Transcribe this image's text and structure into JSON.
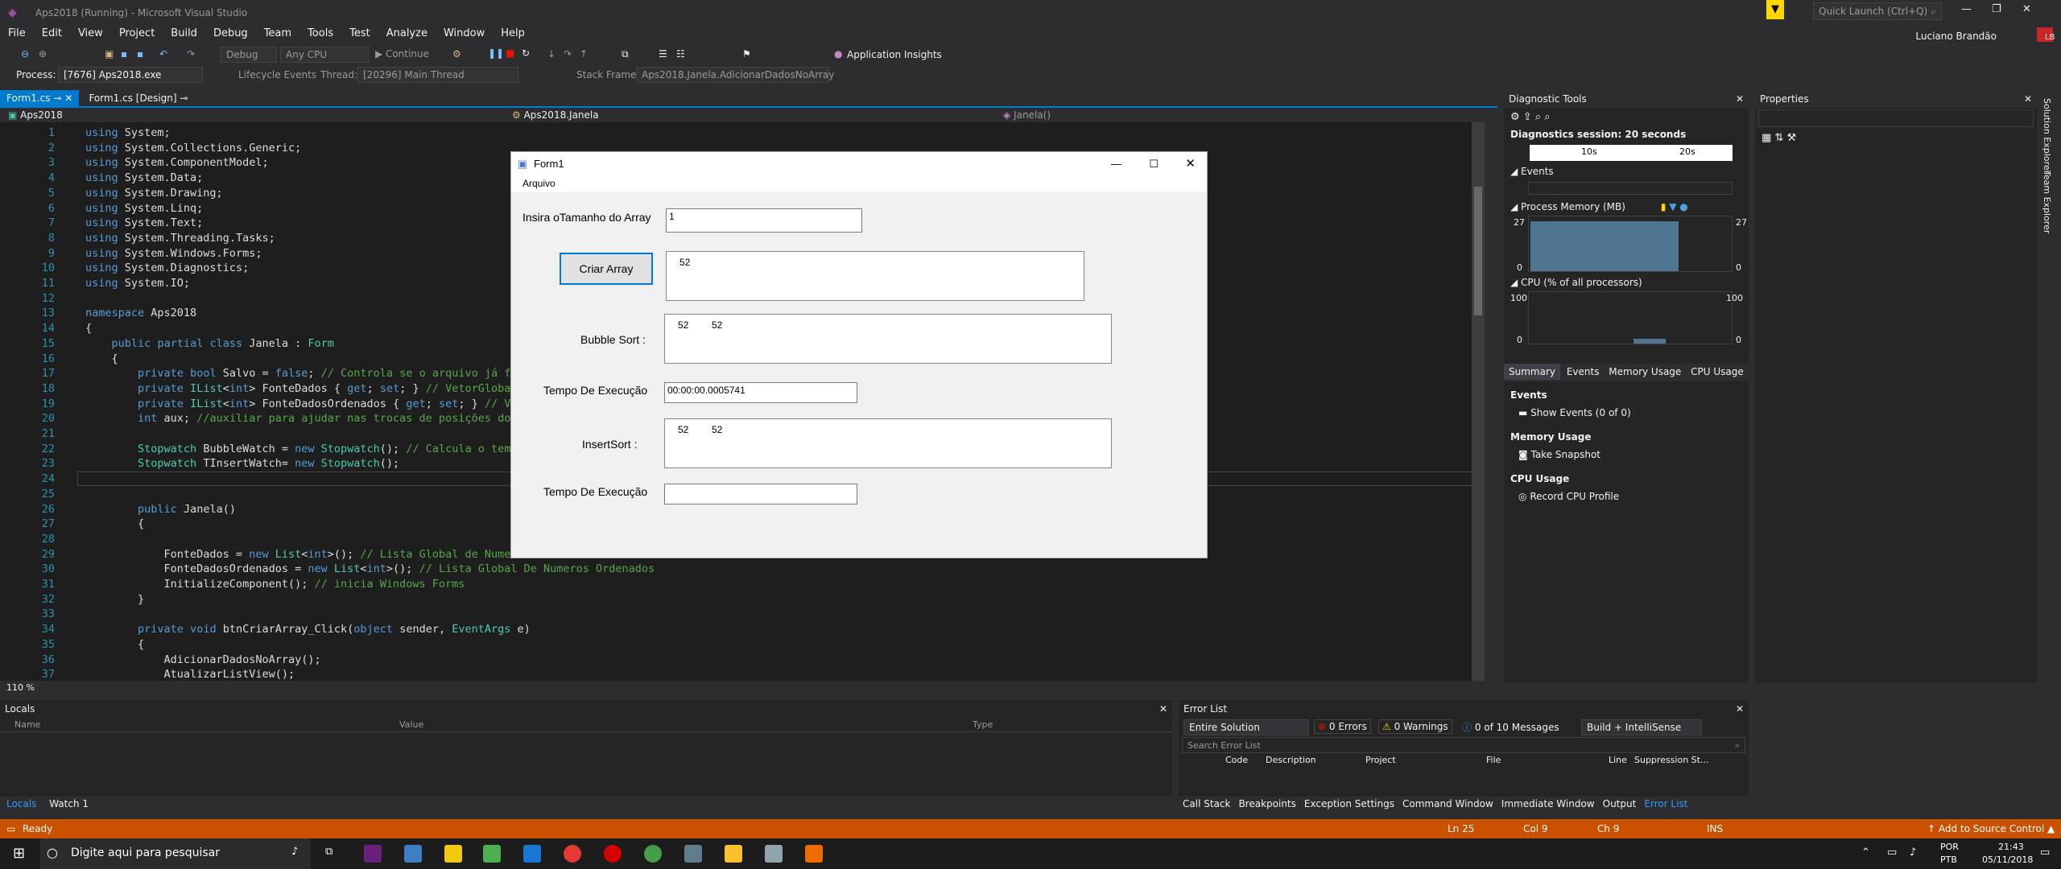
{
  "window": {
    "title": "Aps2018 (Running) - Microsoft Visual Studio",
    "quick_launch": "Quick Launch (Ctrl+Q)",
    "user": "Luciano Brandão",
    "user_initials": "LB"
  },
  "menu": [
    "File",
    "Edit",
    "View",
    "Project",
    "Build",
    "Debug",
    "Team",
    "Tools",
    "Test",
    "Analyze",
    "Window",
    "Help"
  ],
  "toolbar": {
    "config": "Debug",
    "platform": "Any CPU",
    "continue": "Continue",
    "app_insights": "Application Insights"
  },
  "process": {
    "label": "Process:",
    "value": "[7676] Aps2018.exe",
    "lifecycle": "Lifecycle Events",
    "thread_label": "Thread:",
    "thread": "[20296] Main Thread",
    "stack_label": "Stack Frame:",
    "stack": "Aps2018.Janela.AdicionarDadosNoArray"
  },
  "tabs": [
    "Form1.cs",
    "Form1.cs [Design]"
  ],
  "nav": {
    "project": "Aps2018",
    "class": "Aps2018.Janela",
    "member": "Janela()"
  },
  "zoom": "110 %",
  "code_lines": [
    {
      "n": "1",
      "t": "using System;"
    },
    {
      "n": "2",
      "t": "using System.Collections.Generic;"
    },
    {
      "n": "3",
      "t": "using System.ComponentModel;"
    },
    {
      "n": "4",
      "t": "using System.Data;"
    },
    {
      "n": "5",
      "t": "using System.Drawing;"
    },
    {
      "n": "6",
      "t": "using System.Linq;"
    },
    {
      "n": "7",
      "t": "using System.Text;"
    },
    {
      "n": "8",
      "t": "using System.Threading.Tasks;"
    },
    {
      "n": "9",
      "t": "using System.Windows.Forms;"
    },
    {
      "n": "10",
      "t": "using System.Diagnostics;"
    },
    {
      "n": "11",
      "t": "using System.IO;"
    },
    {
      "n": "12",
      "t": ""
    },
    {
      "n": "13",
      "t": "namespace Aps2018"
    },
    {
      "n": "14",
      "t": "{"
    },
    {
      "n": "15",
      "t": "    public partial class Janela : Form"
    },
    {
      "n": "16",
      "t": "    {"
    },
    {
      "n": "17",
      "t": "        private bool Salvo = false; // Controla se o arquivo já foi"
    },
    {
      "n": "18",
      "t": "        private IList<int> FonteDados { get; set; } // VetorGlobal"
    },
    {
      "n": "19",
      "t": "        private IList<int> FonteDadosOrdenados { get; set; } // Vet"
    },
    {
      "n": "20",
      "t": "        int aux; //auxiliar para ajudar nas trocas de posições dos"
    },
    {
      "n": "21",
      "t": ""
    },
    {
      "n": "22",
      "t": "        Stopwatch BubbleWatch = new Stopwatch(); // Calcula o tempo"
    },
    {
      "n": "23",
      "t": "        Stopwatch TInsertWatch= new Stopwatch();"
    },
    {
      "n": "24",
      "t": ""
    },
    {
      "n": "25",
      "t": ""
    },
    {
      "n": "26",
      "t": "        public Janela()"
    },
    {
      "n": "27",
      "t": "        {"
    },
    {
      "n": "28",
      "t": ""
    },
    {
      "n": "29",
      "t": "            FonteDados = new List<int>(); // Lista Global de Numero"
    },
    {
      "n": "30",
      "t": "            FonteDadosOrdenados = new List<int>(); // Lista Global De Numeros Ordenados"
    },
    {
      "n": "31",
      "t": "            InitializeComponent(); // inicia Windows Forms"
    },
    {
      "n": "32",
      "t": "        }"
    },
    {
      "n": "33",
      "t": ""
    },
    {
      "n": "34",
      "t": "        private void btnCriarArray_Click(object sender, EventArgs e)"
    },
    {
      "n": "35",
      "t": "        {"
    },
    {
      "n": "36",
      "t": "            AdicionarDadosNoArray();"
    },
    {
      "n": "37",
      "t": "            AtualizarListView();"
    }
  ],
  "form": {
    "title": "Form1",
    "menu": "Arquivo",
    "size_label": "Insira oTamanho do Array",
    "size_value": "1",
    "create_button": "Criar Array",
    "list1": [
      "52"
    ],
    "bubble_label": "Bubble Sort :",
    "list2": [
      "52",
      "52"
    ],
    "time_label1": "Tempo De Execução",
    "time_value1": "00:00:00.0005741",
    "insert_label": "InsertSort :",
    "list3": [
      "52",
      "52"
    ],
    "time_label2": "Tempo De Execução",
    "time_value2": ""
  },
  "diagnostics": {
    "title": "Diagnostic Tools",
    "session": "Diagnostics session: 20 seconds",
    "t1": "10s",
    "t2": "20s",
    "events": "Events",
    "memory": "Process Memory (MB)",
    "mem_max": "27",
    "mem_min": "0",
    "cpu": "CPU (% of all processors)",
    "cpu_max": "100",
    "cpu_min": "0",
    "tabs": [
      "Summary",
      "Events",
      "Memory Usage",
      "CPU Usage"
    ],
    "sec_events": "Events",
    "show_events": "Show Events (0 of 0)",
    "sec_memory": "Memory Usage",
    "take_snapshot": "Take Snapshot",
    "sec_cpu": "CPU Usage",
    "record_cpu": "Record CPU Profile"
  },
  "properties": {
    "title": "Properties"
  },
  "side_tabs": [
    "Solution Explorer",
    "Team Explorer"
  ],
  "locals": {
    "title": "Locals",
    "columns": [
      "Name",
      "Value",
      "Type"
    ],
    "tabs": [
      "Locals",
      "Watch 1"
    ]
  },
  "errors": {
    "title": "Error List",
    "scope": "Entire Solution",
    "errors": "0 Errors",
    "warnings": "0 Warnings",
    "messages": "0 of 10 Messages",
    "build": "Build + IntelliSense",
    "search": "Search Error List",
    "columns": [
      "Code",
      "Description",
      "Project",
      "File",
      "Line",
      "Suppression St..."
    ],
    "tabs": [
      "Call Stack",
      "Breakpoints",
      "Exception Settings",
      "Command Window",
      "Immediate Window",
      "Output",
      "Error List"
    ]
  },
  "status": {
    "ready": "Ready",
    "ln": "Ln 25",
    "col": "Col 9",
    "ch": "Ch 9",
    "ins": "INS",
    "source_control": "Add to Source Control"
  },
  "taskbar": {
    "search": "Digite aqui para pesquisar",
    "lang1": "POR",
    "lang2": "PTB",
    "time": "21:43",
    "date": "05/11/2018"
  },
  "colors": {
    "accent": "#007acc",
    "status": "#ca5100"
  }
}
